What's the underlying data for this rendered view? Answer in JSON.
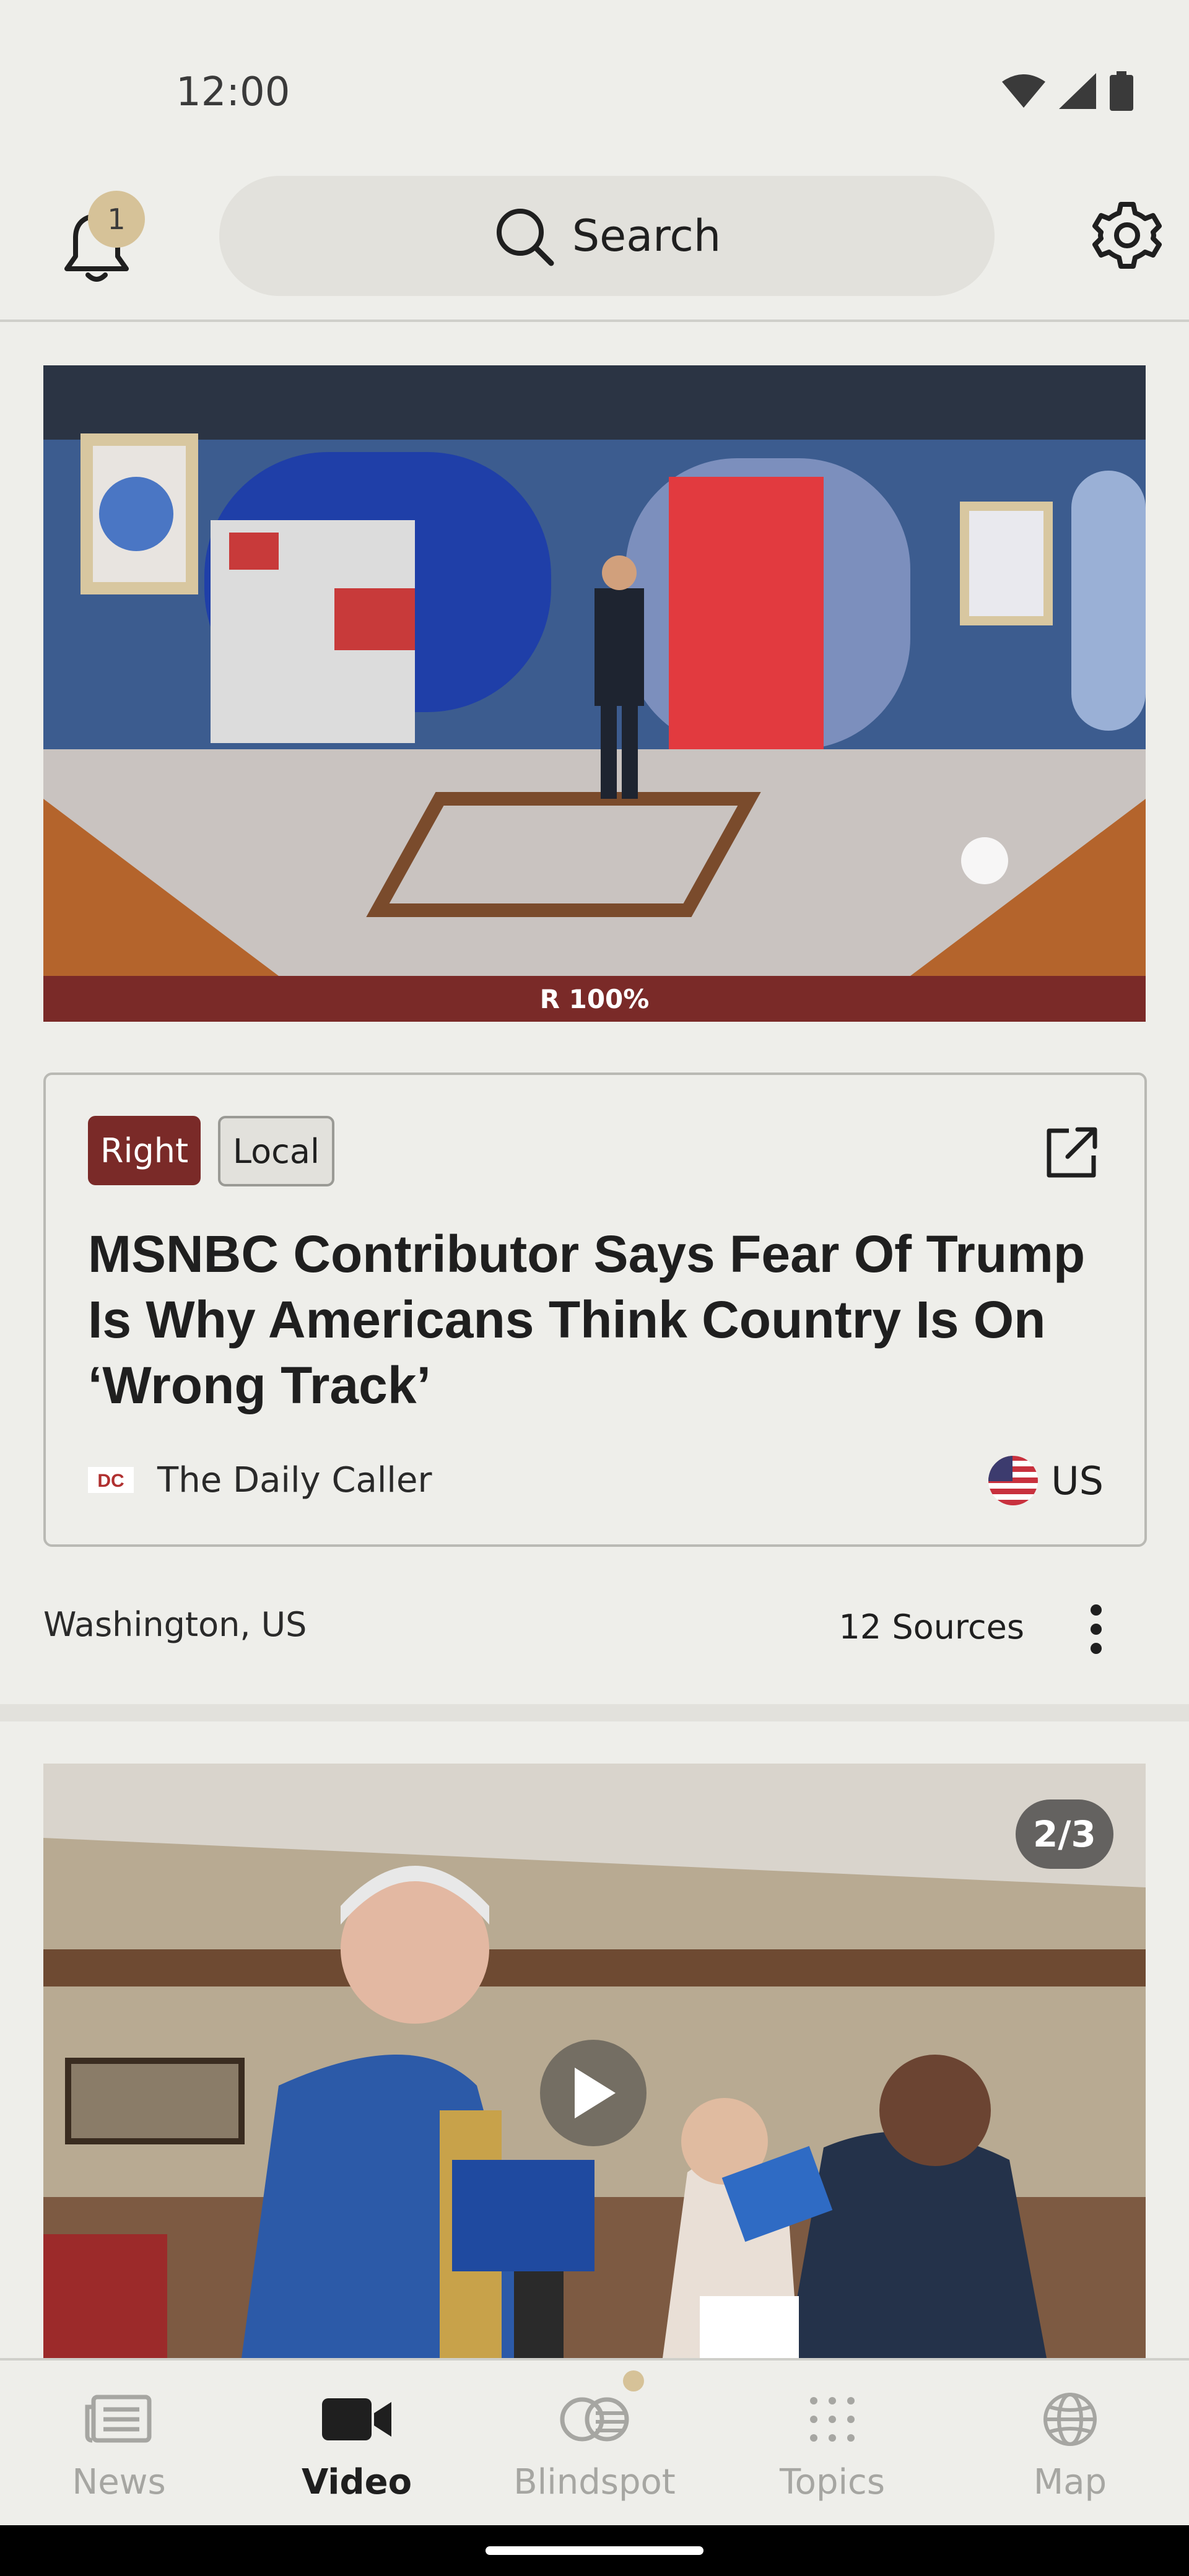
{
  "status_bar": {
    "time": "12:00"
  },
  "header": {
    "notification_count": "1",
    "search_label": "Search"
  },
  "story": {
    "bias_bar_label": "R 100%",
    "bias_percent_right": 100,
    "tags": [
      "Right",
      "Local"
    ],
    "headline": "MSNBC Contributor Says Fear Of Trump Is Why Americans Think Country Is On ‘Wrong Track’",
    "source_logo_text": "DC",
    "source_name": "The Daily Caller",
    "country": "US",
    "location": "Washington, US",
    "sources_count": "12 Sources"
  },
  "second_story": {
    "pager": "2/3"
  },
  "nav": {
    "items": [
      {
        "label": "News",
        "icon": "news-icon"
      },
      {
        "label": "Video",
        "icon": "video-icon"
      },
      {
        "label": "Blindspot",
        "icon": "blindspot-icon"
      },
      {
        "label": "Topics",
        "icon": "topics-icon"
      },
      {
        "label": "Map",
        "icon": "globe-icon"
      }
    ],
    "active": "Video"
  },
  "colors": {
    "background": "#eeeeea",
    "right_bias": "#7a2a28",
    "badge": "#d6c298",
    "inactive": "#a6a6a2"
  }
}
